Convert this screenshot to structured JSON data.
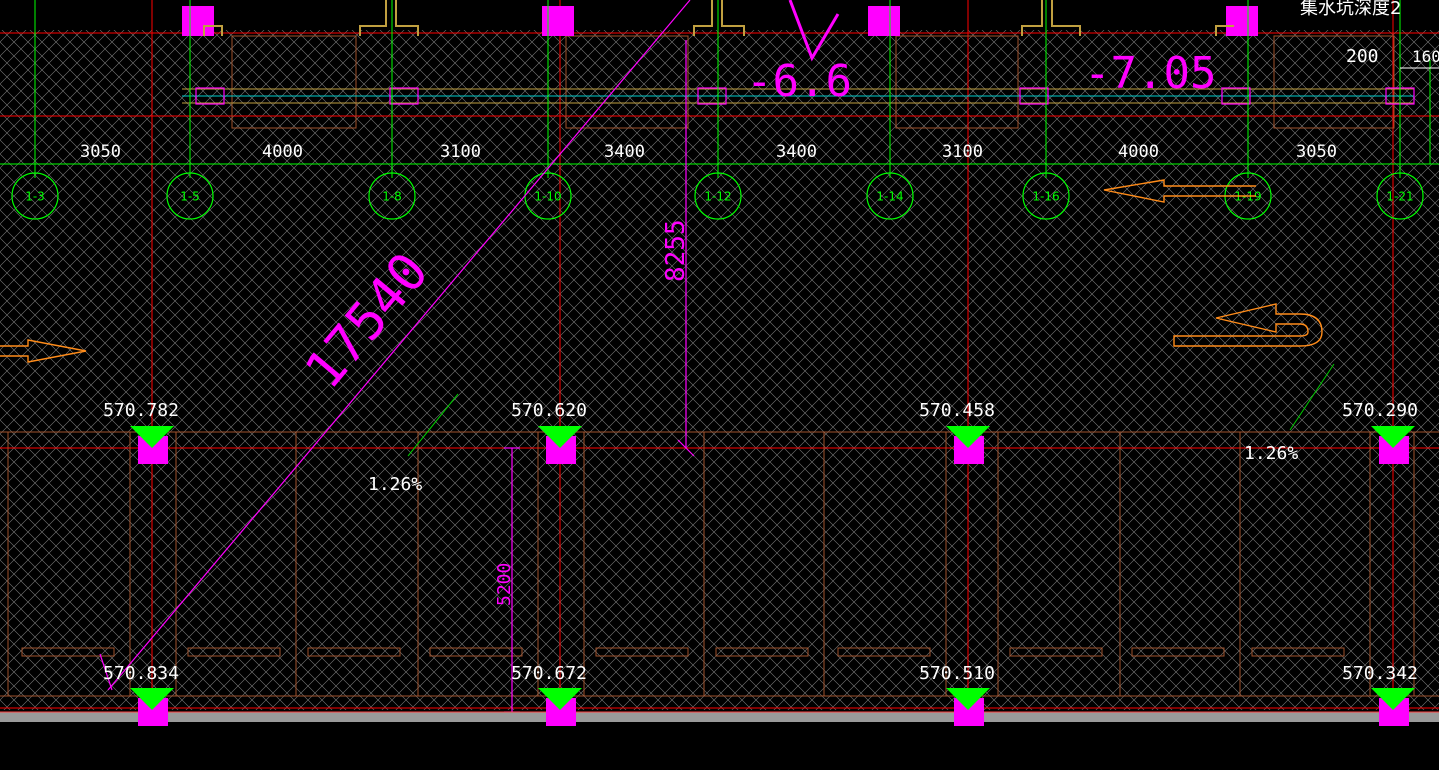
{
  "title_fragment": "集水坑深度2",
  "top_dims": {
    "left": "200",
    "right": "160"
  },
  "elev_labels": {
    "a": "-6.6",
    "b": "-7.05"
  },
  "dimensions": [
    "3050",
    "4000",
    "3100",
    "3400",
    "3400",
    "3100",
    "4000",
    "3050"
  ],
  "grid_axes": [
    "1-3",
    "1-5",
    "1-8",
    "1-10",
    "1-12",
    "1-14",
    "1-16",
    "1-19",
    "1-21"
  ],
  "diag_dim": "17540",
  "vert_dim_a": "8255",
  "vert_dim_b": "5200",
  "slope_label": "1.26%",
  "elevations_top": [
    "570.782",
    "570.620",
    "570.458",
    "570.290"
  ],
  "elevations_bottom": [
    "570.834",
    "570.672",
    "570.510",
    "570.342"
  ],
  "colors": {
    "background": "#000000",
    "grid_red": "#ff0000",
    "axis_green": "#00ff00",
    "dim_magenta": "#ff00ff",
    "arrow_orange": "#ff8c1a",
    "hatch": "#9a9a9a"
  }
}
